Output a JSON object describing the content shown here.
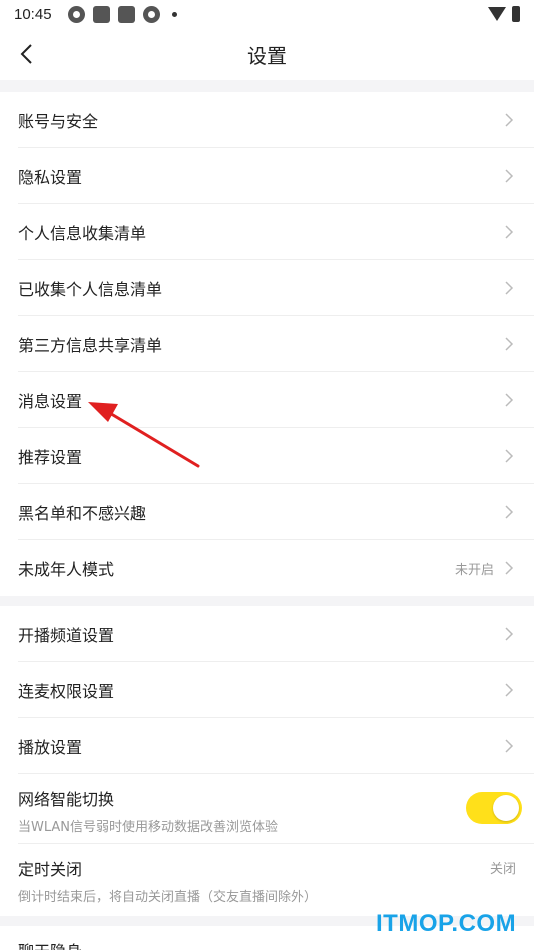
{
  "status_bar": {
    "time": "10:45",
    "icons": [
      "pinwheel-icon",
      "square-app-icon",
      "square-app-icon",
      "pinwheel-icon",
      "dot-icon"
    ],
    "right_icons": [
      "wifi-icon",
      "battery-charging-icon"
    ]
  },
  "header": {
    "title": "设置"
  },
  "groups": [
    {
      "items": [
        {
          "label": "账号与安全"
        },
        {
          "label": "隐私设置"
        },
        {
          "label": "个人信息收集清单"
        },
        {
          "label": "已收集个人信息清单"
        },
        {
          "label": "第三方信息共享清单"
        },
        {
          "label": "消息设置"
        },
        {
          "label": "推荐设置"
        },
        {
          "label": "黑名单和不感兴趣"
        },
        {
          "label": "未成年人模式",
          "value": "未开启"
        }
      ]
    },
    {
      "items": [
        {
          "label": "开播频道设置"
        },
        {
          "label": "连麦权限设置"
        },
        {
          "label": "播放设置"
        }
      ]
    }
  ],
  "network_switch": {
    "label": "网络智能切换",
    "subtitle": "当WLAN信号弱时使用移动数据改善浏览体验",
    "enabled": true
  },
  "timer_close": {
    "label": "定时关闭",
    "value": "关闭",
    "subtitle": "倒计时结束后，将自动关闭直播（交友直播间除外）"
  },
  "next_section_partial": {
    "label": "聊天隐身"
  },
  "annotation": {
    "color": "#e02020",
    "points_to": "消息设置"
  },
  "watermark": {
    "text": "ITMOP.COM",
    "color": "#19a3e8"
  },
  "colors": {
    "toggle_on": "#ffe01a",
    "separator": "#f4f4f6",
    "secondary_text": "#999999"
  }
}
